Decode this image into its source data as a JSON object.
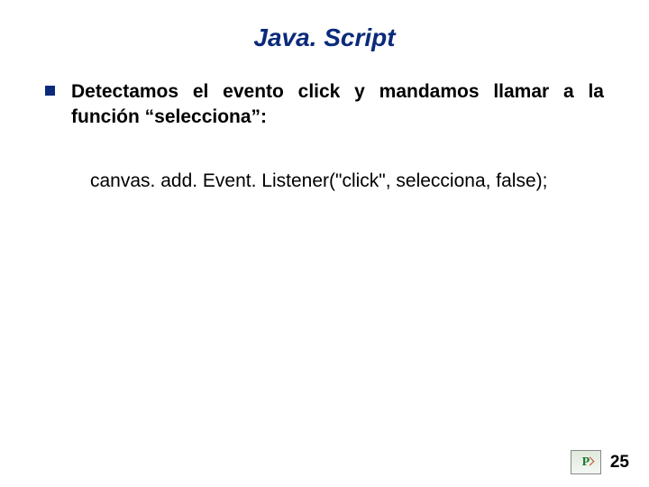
{
  "title": "Java. Script",
  "bullet": {
    "text": "Detectamos el evento click y mandamos llamar a la función “selecciona”:"
  },
  "code_line": "canvas. add. Event. Listener(\"click\", selecciona, false);",
  "logo": {
    "label": "P"
  },
  "page_number": "25"
}
